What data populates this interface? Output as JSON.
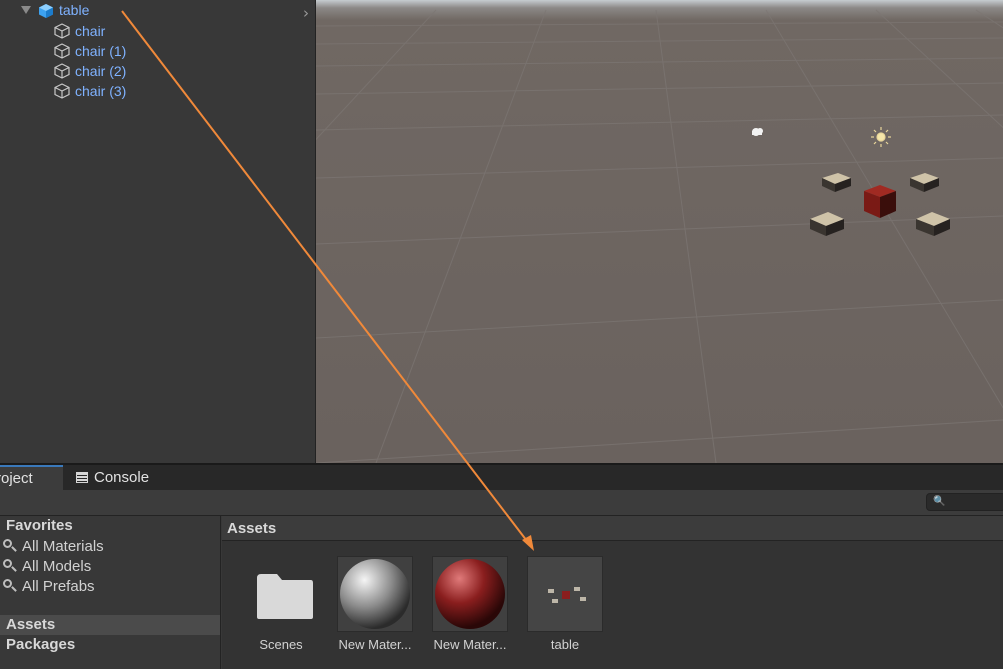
{
  "hierarchy": {
    "root": {
      "label": "table",
      "icon": "prefab-cube-icon"
    },
    "children": [
      {
        "label": "chair"
      },
      {
        "label": "chair (1)"
      },
      {
        "label": "chair (2)"
      },
      {
        "label": "chair (3)"
      }
    ],
    "expand_icon": "chevron-right-icon"
  },
  "tabs": {
    "project": "roject",
    "console": "Console"
  },
  "project_tree": {
    "favorites_label": "Favorites",
    "favorites": [
      "All Materials",
      "All Models",
      "All Prefabs"
    ],
    "assets_label": "Assets",
    "packages_label": "Packages"
  },
  "assets_panel": {
    "header": "Assets",
    "items": [
      {
        "name": "Scenes",
        "kind": "folder"
      },
      {
        "name": "New Mater...",
        "kind": "material",
        "color": "#9a9a9a"
      },
      {
        "name": "New Mater...",
        "kind": "material",
        "color": "#8a1e1e"
      },
      {
        "name": "table",
        "kind": "prefab"
      }
    ]
  },
  "colors": {
    "selection_text": "#7fb2ff",
    "annotation_arrow": "#f0893a",
    "tab_accent": "#3a79bb"
  }
}
